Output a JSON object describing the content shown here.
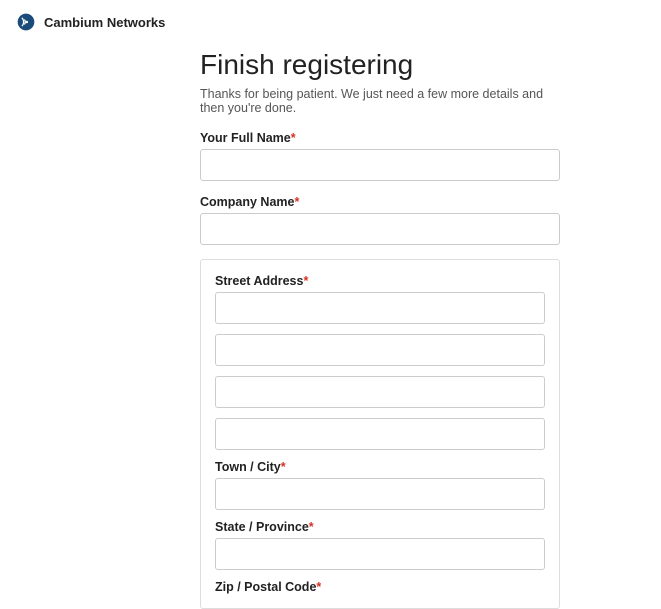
{
  "brand": {
    "name": "Cambium Networks"
  },
  "page": {
    "title": "Finish registering",
    "subtitle": "Thanks for being patient. We just need a few more details and then you're done."
  },
  "fields": {
    "full_name_label": "Your Full Name",
    "company_label": "Company Name",
    "street_label": "Street Address",
    "town_label": "Town / City",
    "state_label": "State / Province",
    "zip_label": "Zip / Postal Code",
    "required_mark": "*"
  }
}
